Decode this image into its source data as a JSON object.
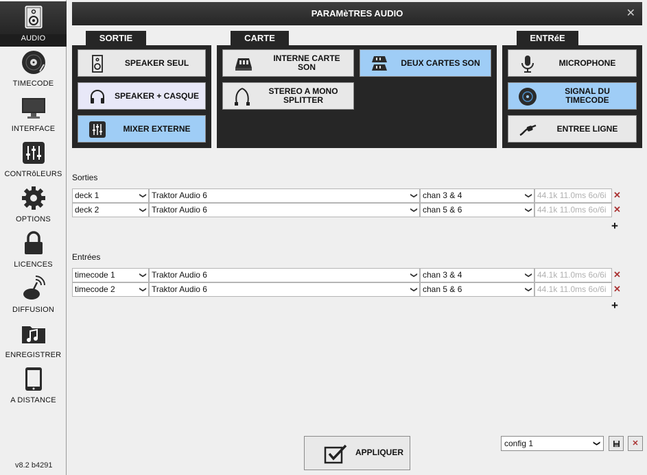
{
  "sidebar": {
    "items": [
      {
        "label": "AUDIO",
        "icon": "speaker-icon"
      },
      {
        "label": "TIMECODE",
        "icon": "vinyl-icon"
      },
      {
        "label": "INTERFACE",
        "icon": "monitor-icon"
      },
      {
        "label": "CONTRôLEURS",
        "icon": "sliders-icon"
      },
      {
        "label": "OPTIONS",
        "icon": "gear-icon"
      },
      {
        "label": "LICENCES",
        "icon": "lock-icon"
      },
      {
        "label": "DIFFUSION",
        "icon": "broadcast-icon"
      },
      {
        "label": "ENREGISTRER",
        "icon": "music-folder-icon"
      },
      {
        "label": "A DISTANCE",
        "icon": "tablet-icon"
      }
    ],
    "version": "v8.2 b4291"
  },
  "window": {
    "title": "PARAMèTRES AUDIO",
    "close": "✕"
  },
  "sortie": {
    "tab": "SORTIE",
    "options": [
      {
        "label": "SPEAKER SEUL",
        "icon": "speaker-icon"
      },
      {
        "label": "SPEAKER + CASQUE",
        "icon": "headphones-icon"
      },
      {
        "label": "MIXER EXTERNE",
        "icon": "mixer-icon"
      }
    ]
  },
  "carte": {
    "tab": "CARTE",
    "options": [
      {
        "label": "INTERNE CARTE SON",
        "icon": "soundcard-icon"
      },
      {
        "label": "DEUX CARTES SON",
        "icon": "two-soundcards-icon"
      },
      {
        "label": "STEREO A MONO SPLITTER",
        "icon": "splitter-cable-icon"
      }
    ]
  },
  "entree": {
    "tab": "ENTRéE",
    "options": [
      {
        "label": "MICROPHONE",
        "icon": "microphone-icon"
      },
      {
        "label": "SIGNAL DU TIMECODE",
        "icon": "timecode-disc-icon"
      },
      {
        "label": "ENTREE LIGNE",
        "icon": "line-cable-icon"
      }
    ]
  },
  "outputs": {
    "title": "Sorties",
    "rows": [
      {
        "deck": "deck 1",
        "device": "Traktor Audio 6",
        "channel": "chan 3 & 4",
        "info": "44.1k 11.0ms 6o/6i"
      },
      {
        "deck": "deck 2",
        "device": "Traktor Audio 6",
        "channel": "chan 5 & 6",
        "info": "44.1k 11.0ms 6o/6i"
      }
    ],
    "add": "+"
  },
  "inputs": {
    "title": "Entrées",
    "rows": [
      {
        "deck": "timecode 1",
        "device": "Traktor Audio 6",
        "channel": "chan 3 & 4",
        "info": "44.1k 11.0ms 6o/6i"
      },
      {
        "deck": "timecode 2",
        "device": "Traktor Audio 6",
        "channel": "chan 5 & 6",
        "info": "44.1k 11.0ms 6o/6i"
      }
    ],
    "add": "+"
  },
  "footer": {
    "apply": "APPLIQUER",
    "config": "config 1"
  },
  "colors": {
    "selected": "#9fcdf6",
    "panel": "#262626",
    "delete": "#aa3333"
  }
}
